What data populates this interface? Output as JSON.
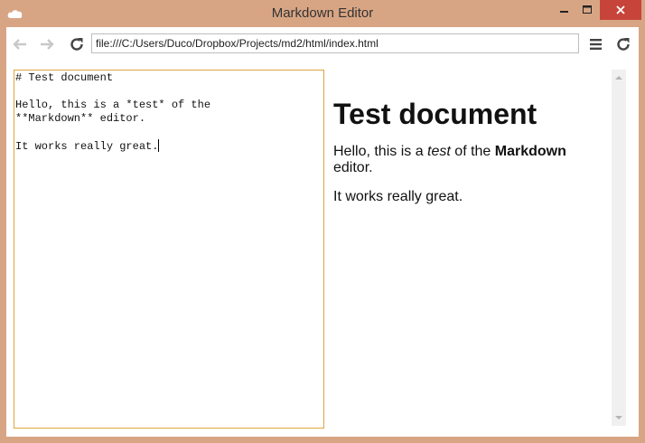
{
  "window": {
    "title": "Markdown Editor",
    "icon": "cloud-icon",
    "close_color": "#c7443a",
    "frame_color": "#d8a584"
  },
  "toolbar": {
    "back_icon": "arrow-left-icon",
    "forward_icon": "arrow-right-icon",
    "reload_icon": "reload-icon",
    "menu_icon": "hamburger-menu-icon",
    "address": "file:///C:/Users/Duco/Dropbox/Projects/md2/html/index.html"
  },
  "editor": {
    "border_color": "#e0a53d",
    "lines": [
      "# Test document",
      "",
      "Hello, this is a *test* of the",
      "**Markdown** editor.",
      "",
      "It works really great."
    ]
  },
  "preview": {
    "heading": "Test document",
    "p1_before": "Hello, this is a ",
    "p1_em": "test",
    "p1_middle": " of the ",
    "p1_strong": "Markdown",
    "p1_after": " editor.",
    "p2": "It works really great."
  }
}
